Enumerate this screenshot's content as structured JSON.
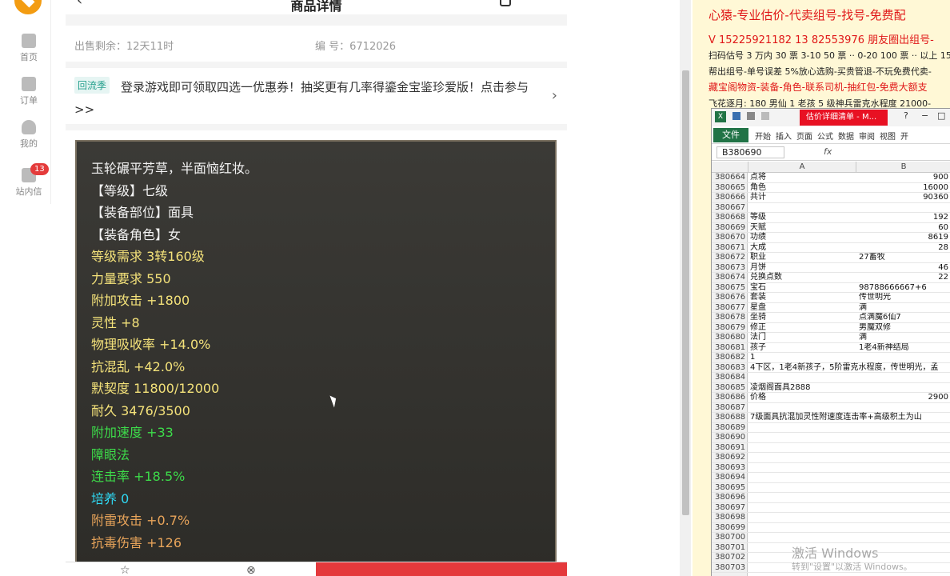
{
  "left_nav": {
    "items": [
      {
        "label": "首页",
        "icon": "home-icon"
      },
      {
        "label": "订单",
        "icon": "order-icon"
      },
      {
        "label": "我的",
        "icon": "user-icon"
      },
      {
        "label": "站内信",
        "icon": "mail-icon",
        "badge": "13"
      }
    ]
  },
  "header": {
    "back_glyph": "‹",
    "title": "商品详情"
  },
  "info": {
    "remaining": "出售剩余：12天11时",
    "serial": "编 号：6712026"
  },
  "promo": {
    "tag": "回流季",
    "text": "登录游戏即可领取四选一优惠券！抽奖更有几率得鎏金宝鉴珍爱版！点击参与>>",
    "arrow": "›"
  },
  "item_card": {
    "lines": [
      {
        "text": "玉轮碾平芳草，半面恼红妆。",
        "color": "#f2f2f2"
      },
      {
        "text": "【等级】七级",
        "color": "#f2f2f2"
      },
      {
        "text": "【装备部位】面具",
        "color": "#f2f2f2"
      },
      {
        "text": "【装备角色】女",
        "color": "#f2f2f2"
      },
      {
        "text": "等级需求 3转160级",
        "color": "#f4e27a"
      },
      {
        "text": "力量要求 550",
        "color": "#f4e27a"
      },
      {
        "text": "附加攻击 +1800",
        "color": "#f4e27a"
      },
      {
        "text": "灵性 +8",
        "color": "#f4e27a"
      },
      {
        "text": "物理吸收率 +14.0%",
        "color": "#f4e27a"
      },
      {
        "text": "抗混乱 +42.0%",
        "color": "#f4e27a"
      },
      {
        "text": "默契度 11800/12000",
        "color": "#f4e27a"
      },
      {
        "text": "耐久 3476/3500",
        "color": "#f4e27a"
      },
      {
        "text": "附加速度 +33",
        "color": "#3ddb4a"
      },
      {
        "text": "障眼法",
        "color": "#3ddb4a"
      },
      {
        "text": "连击率 +18.5%",
        "color": "#3ddb4a"
      },
      {
        "text": "培养 0",
        "color": "#2fd6f0"
      },
      {
        "text": "附雷攻击 +0.7%",
        "color": "#e8a45a"
      },
      {
        "text": "抗毒伤害 +126",
        "color": "#e8a45a"
      },
      {
        "text": "...",
        "color": "#e8a45a"
      }
    ]
  },
  "bottom": {
    "fav_glyph": "☆",
    "close_glyph": "⊗"
  },
  "right_panel": {
    "title": "心猿-专业估价-代卖组号-找号-免费配",
    "contact": "V 15225921182   13 82553976 朋友圈出组号-",
    "line3": "扫码估号 3 万内 30 票 3-10 50 票 ·· 0-20 100 票 ·· 以上 15",
    "line4": "帮出组号-单号误差 5%放心选购-买贵管退-不玩免费代卖-",
    "line5": "藏宝阁物资-装备-角色-联系司机-抽红包-免费大额支",
    "line6": "飞花逐月: 180 男仙 1 老孩 5 级神兵雷克水程度 21000-"
  },
  "excel": {
    "app_glyph": "X",
    "doc_title": "估价详细清单 - M...",
    "file_tab": "文件",
    "tabs": [
      "开始",
      "插入",
      "页面",
      "公式",
      "数据",
      "审阅",
      "视图",
      "开"
    ],
    "win_buttons": [
      "?",
      "−",
      "□"
    ],
    "name_box": "B380690",
    "fx": "fx",
    "col_a": "A",
    "col_b": "B",
    "rows": [
      {
        "n": "380664",
        "a": "点将",
        "b": "900",
        "num": true
      },
      {
        "n": "380665",
        "a": "角色",
        "b": "16000",
        "num": true
      },
      {
        "n": "380666",
        "a": "共计",
        "b": "90360",
        "num": true
      },
      {
        "n": "380667",
        "a": "",
        "b": "",
        "num": true
      },
      {
        "n": "380668",
        "a": "等级",
        "b": "192",
        "num": true
      },
      {
        "n": "380669",
        "a": "天赋",
        "b": "60",
        "num": true
      },
      {
        "n": "380670",
        "a": "功绩",
        "b": "8619",
        "num": true
      },
      {
        "n": "380671",
        "a": "大成",
        "b": "28",
        "num": true
      },
      {
        "n": "380672",
        "a": "职业",
        "b": "27畜牧",
        "num": false
      },
      {
        "n": "380673",
        "a": "月饼",
        "b": "46",
        "num": true
      },
      {
        "n": "380674",
        "a": "兑换点数",
        "b": "22",
        "num": true
      },
      {
        "n": "380675",
        "a": "宝石",
        "b": "98788666667+6",
        "num": false
      },
      {
        "n": "380676",
        "a": "套装",
        "b": "传世明光",
        "num": false
      },
      {
        "n": "380677",
        "a": "星盘",
        "b": "满",
        "num": false
      },
      {
        "n": "380678",
        "a": "坐骑",
        "b": "点满魔6仙7",
        "num": false
      },
      {
        "n": "380679",
        "a": "修正",
        "b": "男魔双修",
        "num": false
      },
      {
        "n": "380680",
        "a": "法门",
        "b": "满",
        "num": false
      },
      {
        "n": "380681",
        "a": "孩子",
        "b": "1老4新神结局",
        "num": false
      },
      {
        "n": "380682",
        "a": "                    1",
        "b": "",
        "num": false
      },
      {
        "n": "380683",
        "a": "4下区，1老4新孩子，5阶雷克水程度，传世明光，孟",
        "b": "",
        "num": false
      },
      {
        "n": "380684",
        "a": "",
        "b": "",
        "num": false
      },
      {
        "n": "380685",
        "a": "凌烟阁面具2888",
        "b": "",
        "num": false
      },
      {
        "n": "380686",
        "a": "价格",
        "b": "2900",
        "num": true
      },
      {
        "n": "380687",
        "a": "",
        "b": "",
        "num": false
      },
      {
        "n": "380688",
        "a": "7级面具抗混加灵性附速度连击率+高级积土为山",
        "b": "",
        "num": false
      },
      {
        "n": "380689",
        "a": "",
        "b": "",
        "num": false
      },
      {
        "n": "380690",
        "a": "",
        "b": "",
        "num": false
      },
      {
        "n": "380691",
        "a": "",
        "b": "",
        "num": false
      },
      {
        "n": "380692",
        "a": "",
        "b": "",
        "num": false
      },
      {
        "n": "380693",
        "a": "",
        "b": "",
        "num": false
      },
      {
        "n": "380694",
        "a": "",
        "b": "",
        "num": false
      },
      {
        "n": "380695",
        "a": "",
        "b": "",
        "num": false
      },
      {
        "n": "380696",
        "a": "",
        "b": "",
        "num": false
      },
      {
        "n": "380697",
        "a": "",
        "b": "",
        "num": false
      },
      {
        "n": "380698",
        "a": "",
        "b": "",
        "num": false
      },
      {
        "n": "380699",
        "a": "",
        "b": "",
        "num": false
      },
      {
        "n": "380700",
        "a": "",
        "b": "",
        "num": false
      },
      {
        "n": "380701",
        "a": "",
        "b": "",
        "num": false
      },
      {
        "n": "380702",
        "a": "",
        "b": "",
        "num": false
      },
      {
        "n": "380703",
        "a": "",
        "b": "",
        "num": false
      }
    ]
  },
  "watermark": {
    "line1": "激活 Windows",
    "line2": "转到\"设置\"以激活 Windows。"
  }
}
